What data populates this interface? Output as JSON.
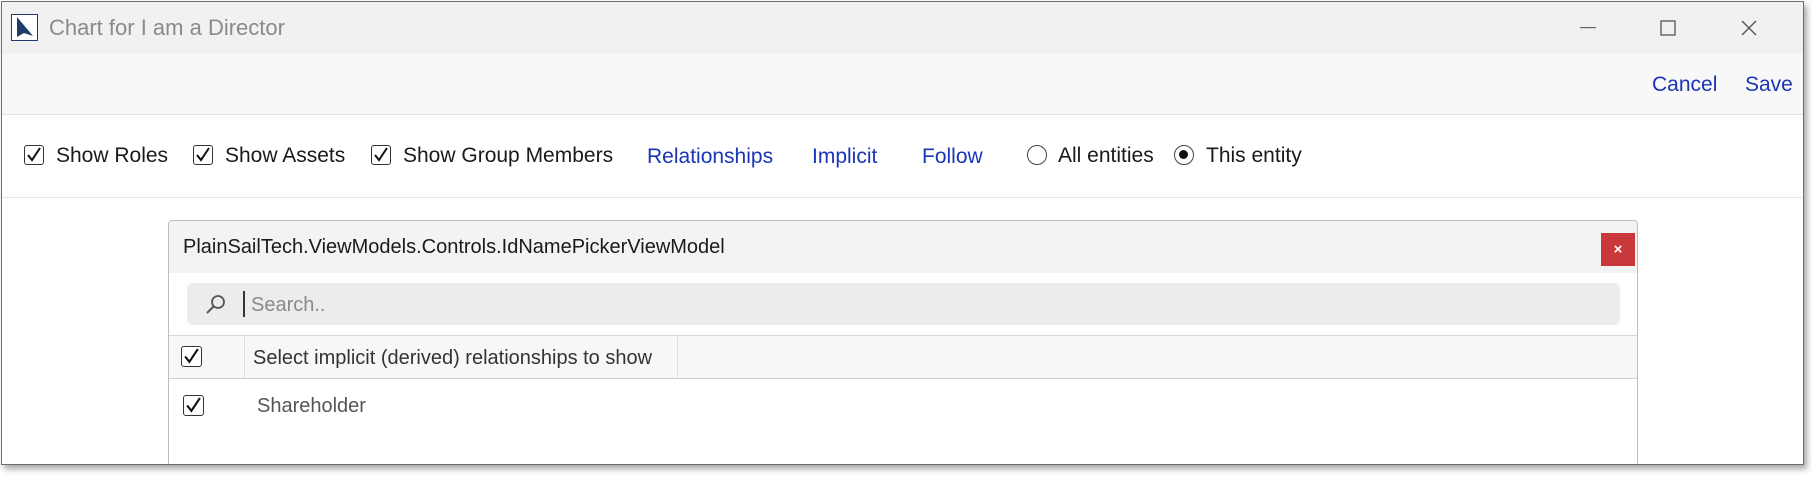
{
  "window": {
    "title": "Chart for I am a Director",
    "app_icon": "app-logo-icon"
  },
  "actions": {
    "cancel_label": "Cancel",
    "save_label": "Save"
  },
  "toolbar": {
    "show_roles": {
      "label": "Show Roles",
      "checked": true
    },
    "show_assets": {
      "label": "Show Assets",
      "checked": true
    },
    "show_group_members": {
      "label": "Show Group Members",
      "checked": true
    },
    "links": {
      "relationships": "Relationships",
      "implicit": "Implicit",
      "follow": "Follow"
    },
    "scope": {
      "options": [
        "All entities",
        "This entity"
      ],
      "selected": "This entity"
    }
  },
  "picker": {
    "title": "PlainSailTech.ViewModels.Controls.IdNamePickerViewModel",
    "close_label": "×",
    "search_placeholder": "Search..",
    "header_label": "Select implicit (derived) relationships to show",
    "header_checked": true,
    "rows": [
      {
        "label": "Shareholder",
        "checked": true
      }
    ]
  },
  "colors": {
    "link": "#1a35b5",
    "close_button": "#c9393c"
  }
}
